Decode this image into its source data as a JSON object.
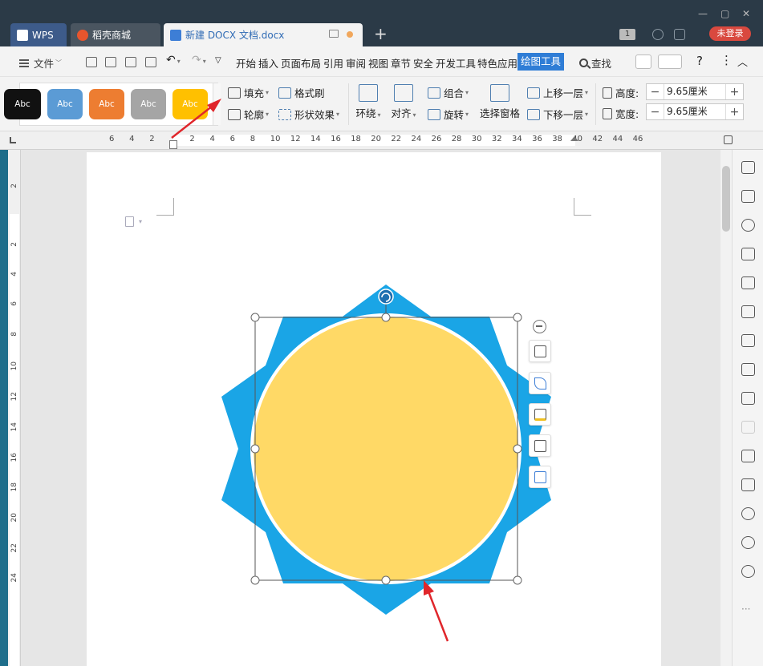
{
  "tabs": [
    {
      "label": "WPS"
    },
    {
      "label": "稻壳商城"
    },
    {
      "label": "新建 DOCX 文档.docx"
    }
  ],
  "login_button": "未登录",
  "window_badge": "1",
  "menu": {
    "file": "文件",
    "items": [
      "开始",
      "插入",
      "页面布局",
      "引用",
      "审阅",
      "视图",
      "章节",
      "安全",
      "开发工具",
      "特色应用"
    ],
    "active": "绘图工具",
    "search": "查找"
  },
  "ribbon": {
    "styles": [
      {
        "label": "Abc",
        "color": "#111111"
      },
      {
        "label": "Abc",
        "color": "#5b9bd5"
      },
      {
        "label": "Abc",
        "color": "#ed7d31"
      },
      {
        "label": "Abc",
        "color": "#a5a5a5"
      },
      {
        "label": "Abc",
        "color": "#ffc000"
      }
    ],
    "fill": "填充",
    "format_painter": "格式刷",
    "outline": "轮廓",
    "shape_effects": "形状效果",
    "wrap": "环绕",
    "align": "对齐",
    "group": "组合",
    "rotate": "旋转",
    "select_pane": "选择窗格",
    "bring_forward": "上移一层",
    "send_backward": "下移一层",
    "height_label": "高度:",
    "height_value": "9.65厘米",
    "width_label": "宽度:",
    "width_value": "9.65厘米"
  },
  "ruler": {
    "h_ticks": [
      "6",
      "4",
      "2",
      "2",
      "4",
      "6",
      "8",
      "10",
      "12",
      "14",
      "16",
      "18",
      "20",
      "22",
      "24",
      "26",
      "28",
      "30",
      "32",
      "34",
      "36",
      "38",
      "40",
      "42",
      "44",
      "46"
    ],
    "v_ticks": [
      "2",
      "2",
      "4",
      "6",
      "8",
      "10",
      "12",
      "14",
      "16",
      "18",
      "20",
      "22",
      "24"
    ]
  },
  "colors": {
    "star_blue": "#1aa5e6",
    "circle_fill": "#ffd966",
    "accent": "#2f7dd6",
    "arrow_red": "#e0262b"
  },
  "icons": {
    "float_toolbar": [
      "minus-circle-icon",
      "wrap-text-icon",
      "pen-icon",
      "fill-icon",
      "outline-icon",
      "layout-icon"
    ],
    "sidebar": [
      "pen-icon",
      "cursor-icon",
      "shapes-icon",
      "triangle-icon",
      "table-icon",
      "apps-icon",
      "sliders-icon",
      "image-gallery-icon",
      "share-icon",
      "link-icon",
      "archive-icon",
      "picture-icon",
      "shield-icon",
      "history-icon",
      "help-icon",
      "more-icon"
    ]
  }
}
